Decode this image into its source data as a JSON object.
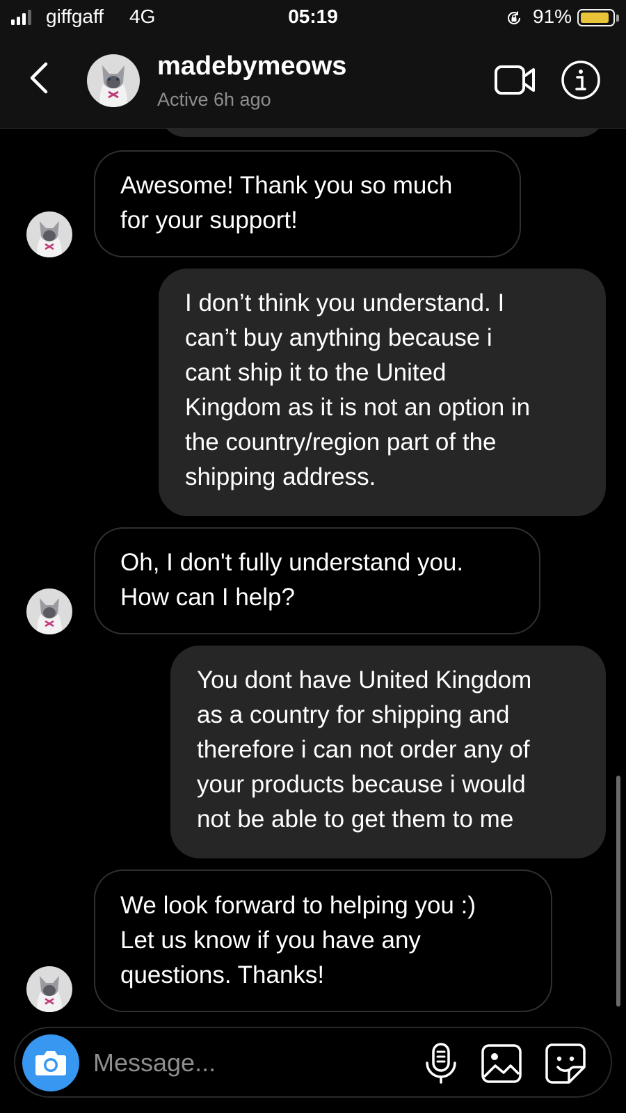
{
  "status_bar": {
    "carrier": "giffgaff",
    "network": "4G",
    "time": "05:19",
    "battery_percent": "91%",
    "battery_level": 0.91
  },
  "header": {
    "username": "madebymeows",
    "active_status": "Active 6h ago"
  },
  "messages": [
    {
      "from": "them",
      "text": "Awesome! Thank you so much\nfor your support!"
    },
    {
      "from": "me",
      "text": "I don’t think you understand. I\ncan’t buy anything because i\ncant ship it to the United\nKingdom as it is not an option in\nthe country/region part of the\nshipping address."
    },
    {
      "from": "them",
      "text": "Oh, I don't fully understand you.\nHow can I help?"
    },
    {
      "from": "me",
      "text": "You dont have United Kingdom\nas a country for shipping and\ntherefore i can not order any of\nyour products because i would\nnot be able to get them to me"
    },
    {
      "from": "them",
      "text": "We look forward to helping you :)\nLet us know if you have any\nquestions. Thanks!"
    }
  ],
  "composer": {
    "placeholder": "Message..."
  },
  "colors": {
    "accent": "#3897f0",
    "battery": "#f5ce3c",
    "sent_bubble": "#262626",
    "secondary_text": "#8e8e8e"
  },
  "icons": [
    "back-chevron-icon",
    "video-call-icon",
    "info-icon",
    "camera-icon",
    "microphone-icon",
    "gallery-icon",
    "sticker-icon"
  ]
}
